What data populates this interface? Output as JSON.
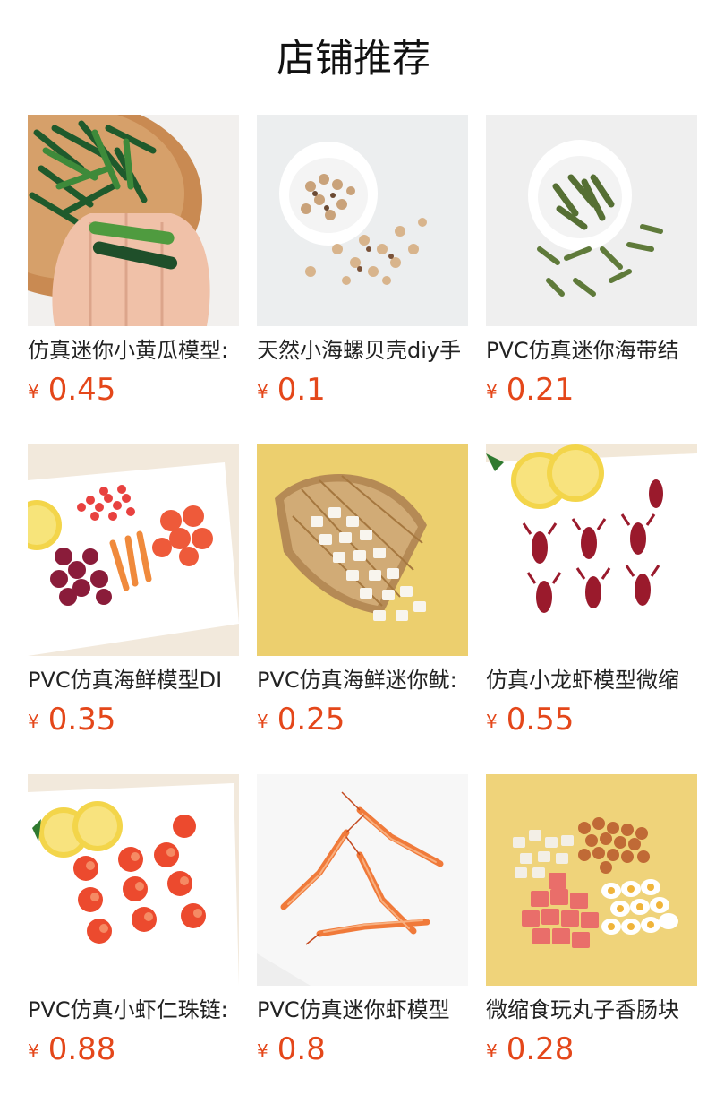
{
  "header": {
    "title": "店铺推荐"
  },
  "products": [
    {
      "name": "仿真迷你小黄瓜模型:",
      "currency": "¥",
      "price": "0.45",
      "image": "cucumber-photo"
    },
    {
      "name": "天然小海螺贝壳diy手",
      "currency": "¥",
      "price": "0.1",
      "image": "seashell-photo"
    },
    {
      "name": "PVC仿真迷你海带结",
      "currency": "¥",
      "price": "0.21",
      "image": "kelp-photo"
    },
    {
      "name": "PVC仿真海鲜模型DI",
      "currency": "¥",
      "price": "0.35",
      "image": "seafood-mix-photo"
    },
    {
      "name": "PVC仿真海鲜迷你鱿:",
      "currency": "¥",
      "price": "0.25",
      "image": "squid-basket-photo"
    },
    {
      "name": "仿真小龙虾模型微缩",
      "currency": "¥",
      "price": "0.55",
      "image": "crayfish-photo"
    },
    {
      "name": "PVC仿真小虾仁珠链:",
      "currency": "¥",
      "price": "0.88",
      "image": "shrimp-meat-photo"
    },
    {
      "name": "PVC仿真迷你虾模型",
      "currency": "¥",
      "price": "0.8",
      "image": "shrimp-photo"
    },
    {
      "name": "微缩食玩丸子香肠块",
      "currency": "¥",
      "price": "0.28",
      "image": "meatball-sausage-photo"
    }
  ]
}
